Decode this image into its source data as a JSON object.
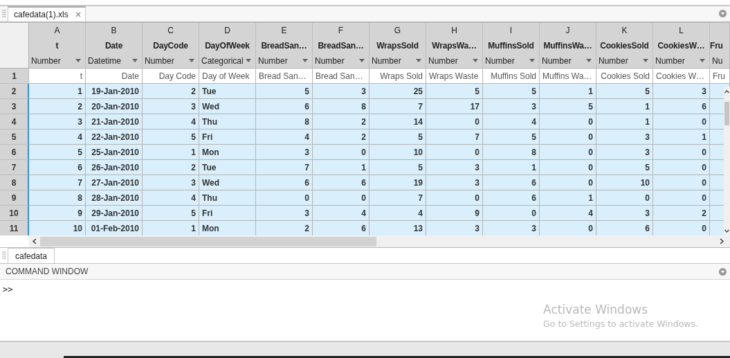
{
  "document_tab": {
    "label": "cafedata(1).xls",
    "selected": true
  },
  "grid": {
    "columns": [
      {
        "letter": "A",
        "name": "t",
        "type": "Number",
        "header_text": "t"
      },
      {
        "letter": "B",
        "name": "Date",
        "type": "Datetime",
        "header_text": "Date"
      },
      {
        "letter": "C",
        "name": "DayCode",
        "type": "Number",
        "header_text": "Day Code"
      },
      {
        "letter": "D",
        "name": "DayOfWeek",
        "type": "Categorical",
        "header_text": "Day of Week"
      },
      {
        "letter": "E",
        "name": "BreadSan…",
        "type": "Number",
        "header_text": "Bread San…"
      },
      {
        "letter": "F",
        "name": "BreadSan…",
        "type": "Number",
        "header_text": "Bread San…"
      },
      {
        "letter": "G",
        "name": "WrapsSold",
        "type": "Number",
        "header_text": "Wraps Sold"
      },
      {
        "letter": "H",
        "name": "WrapsWa…",
        "type": "Number",
        "header_text": "Wraps Waste"
      },
      {
        "letter": "I",
        "name": "MuffinsSold",
        "type": "Number",
        "header_text": "Muffins Sold"
      },
      {
        "letter": "J",
        "name": "MuffinsWa…",
        "type": "Number",
        "header_text": "Muffins Wa…"
      },
      {
        "letter": "K",
        "name": "CookiesSold",
        "type": "Number",
        "header_text": "Cookies Sold"
      },
      {
        "letter": "L",
        "name": "CookiesW…",
        "type": "Number",
        "header_text": "Cookies W…"
      },
      {
        "name": "Fru",
        "type": "Nu",
        "header_text": "Fru"
      }
    ],
    "header_row": {
      "number": "1",
      "selected": false
    },
    "rows": [
      {
        "number": "2",
        "selected": true,
        "cells": [
          "1",
          "19-Jan-2010",
          "2",
          "Tue",
          "5",
          "3",
          "25",
          "5",
          "5",
          "1",
          "5",
          "3"
        ]
      },
      {
        "number": "3",
        "selected": true,
        "cells": [
          "2",
          "20-Jan-2010",
          "3",
          "Wed",
          "6",
          "8",
          "7",
          "17",
          "3",
          "5",
          "1",
          "6"
        ]
      },
      {
        "number": "4",
        "selected": true,
        "cells": [
          "3",
          "21-Jan-2010",
          "4",
          "Thu",
          "8",
          "2",
          "14",
          "0",
          "4",
          "0",
          "1",
          "0"
        ]
      },
      {
        "number": "5",
        "selected": true,
        "cells": [
          "4",
          "22-Jan-2010",
          "5",
          "Fri",
          "4",
          "2",
          "5",
          "7",
          "5",
          "0",
          "3",
          "1"
        ]
      },
      {
        "number": "6",
        "selected": true,
        "cells": [
          "5",
          "25-Jan-2010",
          "1",
          "Mon",
          "3",
          "0",
          "10",
          "0",
          "8",
          "0",
          "3",
          "0"
        ]
      },
      {
        "number": "7",
        "selected": true,
        "cells": [
          "6",
          "26-Jan-2010",
          "2",
          "Tue",
          "7",
          "1",
          "5",
          "3",
          "1",
          "0",
          "5",
          "0"
        ]
      },
      {
        "number": "8",
        "selected": true,
        "cells": [
          "7",
          "27-Jan-2010",
          "3",
          "Wed",
          "6",
          "6",
          "19",
          "3",
          "6",
          "0",
          "10",
          "0"
        ]
      },
      {
        "number": "9",
        "selected": true,
        "cells": [
          "8",
          "28-Jan-2010",
          "4",
          "Thu",
          "0",
          "0",
          "7",
          "0",
          "6",
          "1",
          "0",
          "0"
        ]
      },
      {
        "number": "10",
        "selected": true,
        "cells": [
          "9",
          "29-Jan-2010",
          "5",
          "Fri",
          "3",
          "4",
          "4",
          "9",
          "0",
          "4",
          "3",
          "2"
        ]
      },
      {
        "number": "11",
        "selected": true,
        "cells": [
          "10",
          "01-Feb-2010",
          "1",
          "Mon",
          "2",
          "6",
          "13",
          "3",
          "3",
          "0",
          "6",
          "0"
        ]
      }
    ]
  },
  "sheet_tab": {
    "label": "cafedata",
    "selected": true
  },
  "command_window": {
    "title": "COMMAND WINDOW",
    "prompt": ">>"
  },
  "os_notice": {
    "title": "Activate Windows",
    "subtitle": "Go to Settings to activate Windows."
  }
}
